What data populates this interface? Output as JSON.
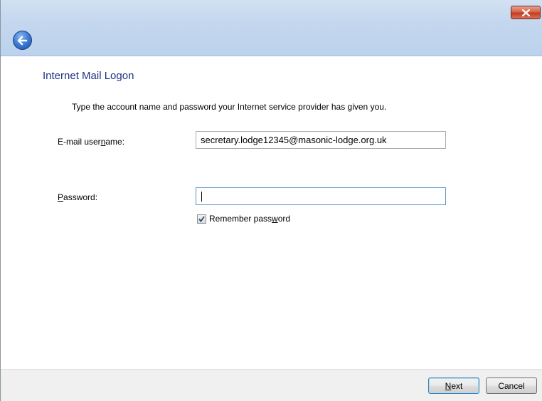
{
  "window": {
    "close_icon": "close-icon",
    "back_icon": "back-arrow-icon"
  },
  "page": {
    "heading": "Internet Mail Logon",
    "instruction": "Type the account name and password your Internet service provider has given you."
  },
  "form": {
    "username_label_pre": "E-mail user",
    "username_label_key": "n",
    "username_label_post": "ame:",
    "username_value": "secretary.lodge12345@masonic-lodge.org.uk",
    "password_label_key": "P",
    "password_label_post": "assword:",
    "password_value": "",
    "remember_pre": "Remember pass",
    "remember_key": "w",
    "remember_post": "ord",
    "remember_checked": true
  },
  "buttons": {
    "next_key": "N",
    "next_rest": "ext",
    "cancel_label": "Cancel"
  },
  "colors": {
    "heading": "#1e3287",
    "close_button": "#c23b22",
    "back_button": "#3f7fd8"
  }
}
